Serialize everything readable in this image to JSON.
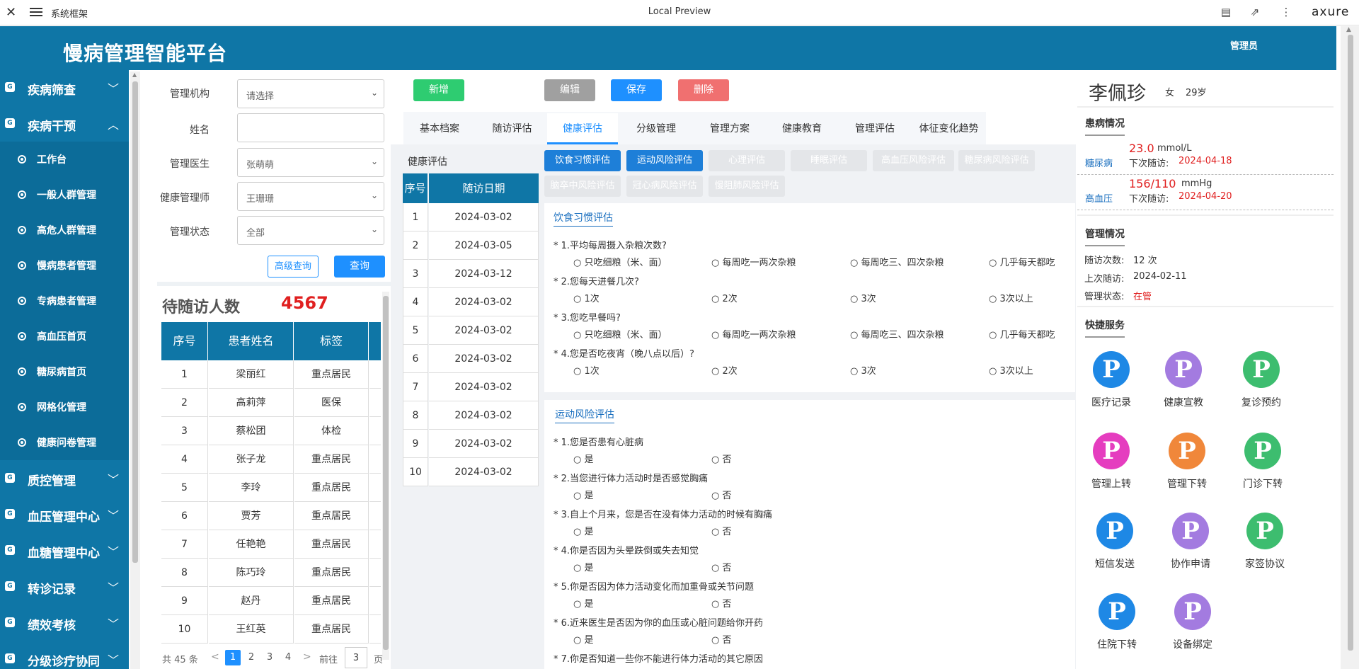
{
  "window": {
    "title": "系统框架",
    "center_title": "Local Preview",
    "brand": "axure"
  },
  "header": {
    "app_name": "慢病管理智能平台",
    "user": "管理员"
  },
  "sidebar": {
    "groups_top": [
      {
        "label": "疾病筛查",
        "expanded": false
      },
      {
        "label": "疾病干预",
        "expanded": true
      }
    ],
    "sub_items": [
      "工作台",
      "一般人群管理",
      "高危人群管理",
      "慢病患者管理",
      "专病患者管理",
      "高血压首页",
      "糖尿病首页",
      "网格化管理",
      "健康问卷管理"
    ],
    "groups_bottom": [
      "质控管理",
      "血压管理中心",
      "血糖管理中心",
      "转诊记录",
      "绩效考核",
      "分级诊疗协同"
    ]
  },
  "filter": {
    "org_label": "管理机构",
    "org_value": "请选择",
    "name_label": "姓名",
    "name_value": "",
    "doctor_label": "管理医生",
    "doctor_value": "张萌萌",
    "hm_label": "健康管理师",
    "hm_value": "王珊珊",
    "status_label": "管理状态",
    "status_value": "全部",
    "advanced_btn": "高级查询",
    "query_btn": "查询"
  },
  "pending": {
    "label": "待随访人数",
    "count": "4567",
    "columns": [
      "序号",
      "患者姓名",
      "标签"
    ],
    "rows": [
      [
        "1",
        "梁丽红",
        "重点居民"
      ],
      [
        "2",
        "高莉萍",
        "医保"
      ],
      [
        "3",
        "蔡松团",
        "体检"
      ],
      [
        "4",
        "张子龙",
        "重点居民"
      ],
      [
        "5",
        "李玲",
        "重点居民"
      ],
      [
        "6",
        "贾芳",
        "重点居民"
      ],
      [
        "7",
        "任艳艳",
        "重点居民"
      ],
      [
        "8",
        "陈巧玲",
        "重点居民"
      ],
      [
        "9",
        "赵丹",
        "重点居民"
      ],
      [
        "10",
        "王红英",
        "重点居民"
      ]
    ],
    "pagination": {
      "total": "共 45 条",
      "prev": "<",
      "pages": [
        "1",
        "2",
        "3",
        "4"
      ],
      "next": ">",
      "goto_label": "前往",
      "goto_value": "3",
      "page_suffix": "页"
    }
  },
  "toolbar": {
    "add": "新增",
    "edit": "编辑",
    "save": "保存",
    "delete": "删除"
  },
  "tabs": [
    "基本档案",
    "随访评估",
    "健康评估",
    "分级管理",
    "管理方案",
    "健康教育",
    "管理评估",
    "体征变化趋势"
  ],
  "active_tab": "健康评估",
  "eval_list": {
    "title": "健康评估",
    "columns": [
      "序号",
      "随访日期"
    ],
    "rows": [
      [
        "1",
        "2024-03-02"
      ],
      [
        "2",
        "2024-03-05"
      ],
      [
        "3",
        "2024-03-12"
      ],
      [
        "4",
        "2024-03-02"
      ],
      [
        "5",
        "2024-03-02"
      ],
      [
        "6",
        "2024-03-02"
      ],
      [
        "7",
        "2024-03-02"
      ],
      [
        "8",
        "2024-03-02"
      ],
      [
        "9",
        "2024-03-02"
      ],
      [
        "10",
        "2024-03-02"
      ]
    ]
  },
  "eval_tags": {
    "row1": [
      "饮食习惯评估",
      "运动风险评估",
      "心理评估",
      "睡眠评估",
      "高血压风险评估",
      "糖尿病风险评估"
    ],
    "row2": [
      "脑卒中风险评估",
      "冠心病风险评估",
      "慢阻肺风险评估"
    ]
  },
  "diet": {
    "title": "饮食习惯评估",
    "questions": [
      {
        "q": "* 1.平均每周摄入杂粮次数?",
        "options": [
          "只吃细粮（米、面）",
          "每周吃一两次杂粮",
          "每周吃三、四次杂粮",
          "几乎每天都吃"
        ]
      },
      {
        "q": "* 2.您每天进餐几次?",
        "options": [
          "1次",
          "2次",
          "3次",
          "3次以上"
        ]
      },
      {
        "q": "* 3.您吃早餐吗?",
        "options": [
          "只吃细粮（米、面）",
          "每周吃一两次杂粮",
          "每周吃三、四次杂粮",
          "几乎每天都吃"
        ]
      },
      {
        "q": "* 4.您是否吃夜宵（晚八点以后）?",
        "options": [
          "1次",
          "2次",
          "3次",
          "3次以上"
        ]
      }
    ]
  },
  "sport": {
    "title": "运动风险评估",
    "questions": [
      "* 1.您是否患有心脏病",
      "* 2.当您进行体力活动时是否感觉胸痛",
      "* 3.自上个月来，您是否在没有体力活动的时候有胸痛",
      "* 4.你是否因为头晕跌倒或失去知觉",
      "* 5.你是否因为体力活动变化而加重骨或关节问题",
      "* 6.近来医生是否因为你的血压或心脏问题给你开药",
      "* 7.你是否知道一些你不能进行体力活动的其它原因"
    ],
    "yes": "是",
    "no": "否"
  },
  "patient": {
    "name": "李佩珍",
    "gender": "女",
    "age": "29岁",
    "conditions_title": "患病情况",
    "conditions": [
      {
        "name": "糖尿病",
        "value": "23.0",
        "unit": "mmol/L",
        "next_label": "下次随访:",
        "next_date": "2024-04-18"
      },
      {
        "name": "高血压",
        "value": "156/110",
        "unit": "mmHg",
        "next_label": "下次随访:",
        "next_date": "2024-04-20"
      }
    ],
    "mgmt_title": "管理情况",
    "visits_label": "随访次数:",
    "visits_value": "12 次",
    "last_label": "上次随访:",
    "last_value": "2024-02-11",
    "status_label": "管理状态:",
    "status_value": "在管"
  },
  "services": {
    "title": "快捷服务",
    "items": [
      {
        "label": "医疗记录",
        "color": "#1e88e5"
      },
      {
        "label": "健康宣教",
        "color": "#a37be0"
      },
      {
        "label": "复诊预约",
        "color": "#3dbd6f"
      },
      {
        "label": "管理上转",
        "color": "#e53dbf"
      },
      {
        "label": "管理下转",
        "color": "#f0873a"
      },
      {
        "label": "门诊下转",
        "color": "#3dbd6f"
      },
      {
        "label": "短信发送",
        "color": "#1e88e5"
      },
      {
        "label": "协作申请",
        "color": "#a37be0"
      },
      {
        "label": "家签协议",
        "color": "#3dbd6f"
      },
      {
        "label": "住院下转",
        "color": "#1e88e5"
      },
      {
        "label": "设备绑定",
        "color": "#a37be0"
      }
    ]
  },
  "colors": {
    "primary": "#0f76a6",
    "accent_red": "#e02020",
    "btn_green": "#2ecc71",
    "btn_blue": "#1e90ff",
    "btn_red": "#f07070",
    "btn_gray": "#a0a0a0",
    "tag_blue": "#1e7fd8"
  }
}
